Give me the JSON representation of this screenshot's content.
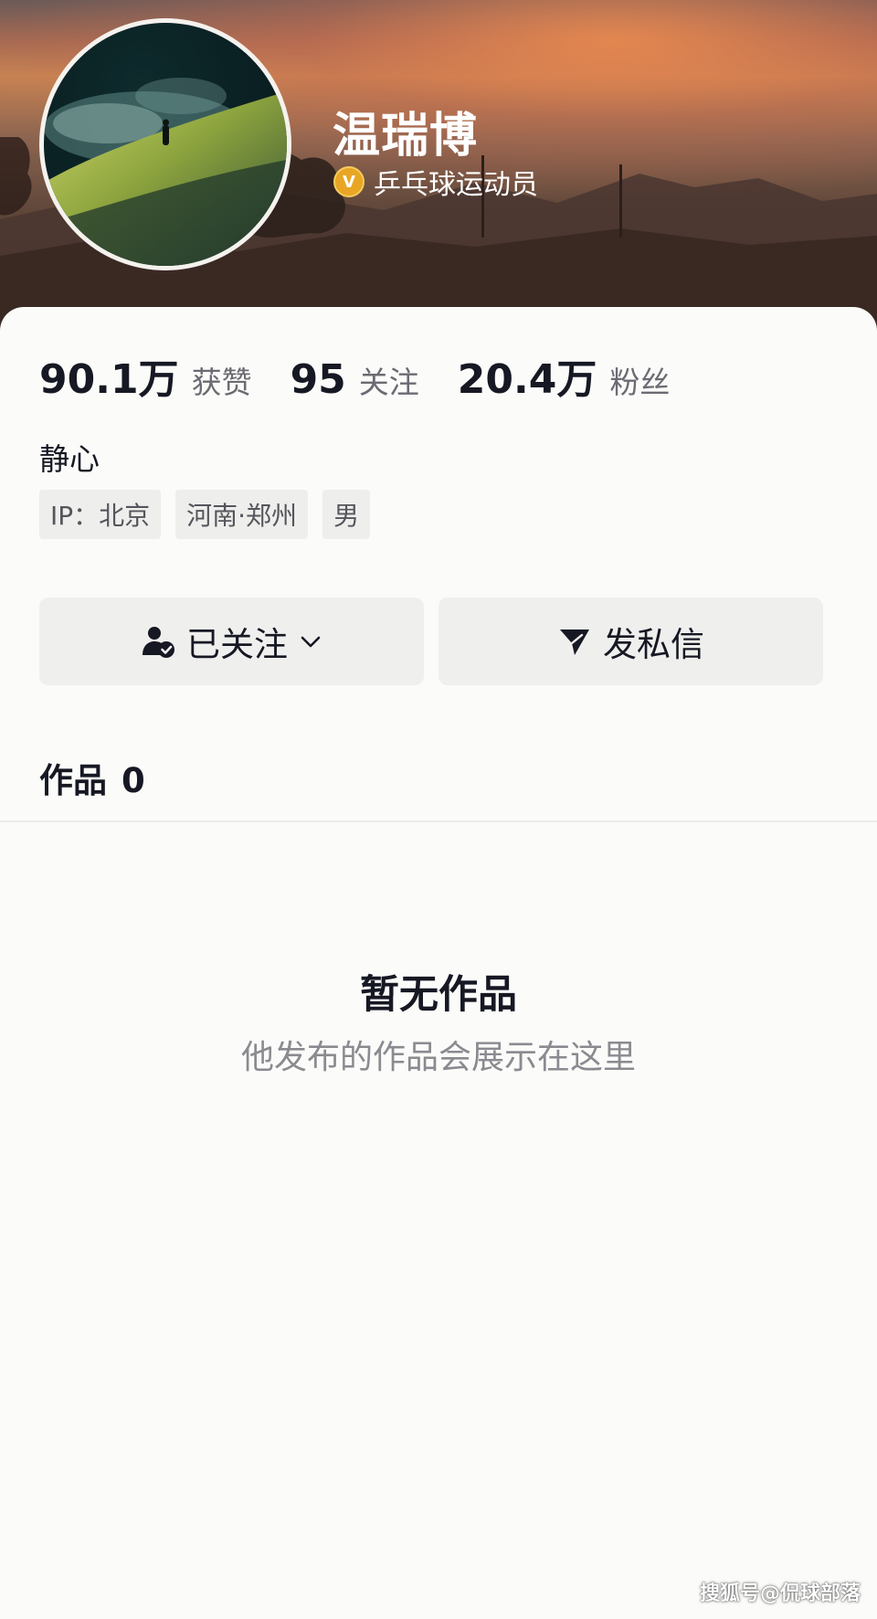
{
  "profile": {
    "name": "温瑞博",
    "verify_badge": "V",
    "verify_title": "乒乓球运动员",
    "bio": "静心"
  },
  "stats": [
    {
      "value": "90.1万",
      "label": "获赞"
    },
    {
      "value": "95",
      "label": "关注"
    },
    {
      "value": "20.4万",
      "label": "粉丝"
    }
  ],
  "tags": [
    "IP：北京",
    "河南·郑州",
    "男"
  ],
  "actions": {
    "follow_label": "已关注",
    "message_label": "发私信"
  },
  "works": {
    "tab_label": "作品",
    "count": "0",
    "empty_title": "暂无作品",
    "empty_subtitle": "他发布的作品会展示在这里"
  },
  "watermark": "搜狐号@侃球部落",
  "colors": {
    "text_primary": "#161823",
    "text_secondary": "#6b6b73",
    "button_bg": "#efefed",
    "verify_badge": "#e8a624"
  },
  "icons": [
    "verified-badge-icon",
    "followed-user-icon",
    "chevron-down-icon",
    "send-message-icon"
  ]
}
